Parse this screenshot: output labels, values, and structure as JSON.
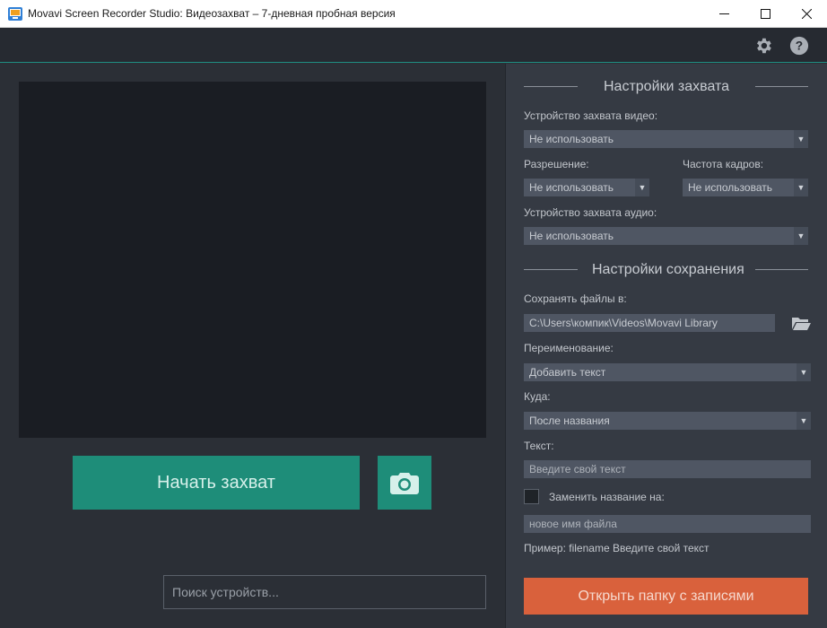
{
  "window": {
    "title": "Movavi Screen Recorder Studio: Видеозахват – 7-дневная пробная версия",
    "minimize_glyph": "—",
    "maximize_glyph": "☐",
    "close_glyph": "✕"
  },
  "toolbar": {
    "settings_icon": "gear-icon",
    "help_icon": "help-icon"
  },
  "preview": {
    "start_label": "Начать захват",
    "snapshot_icon": "camera-icon",
    "search_placeholder": "Поиск устройств..."
  },
  "capture_settings": {
    "title": "Настройки захвата",
    "video_device_label": "Устройство захвата видео:",
    "video_device_value": "Не использовать",
    "resolution_label": "Разрешение:",
    "resolution_value": "Не использовать",
    "framerate_label": "Частота кадров:",
    "framerate_value": "Не использовать",
    "audio_device_label": "Устройство захвата аудио:",
    "audio_device_value": "Не использовать"
  },
  "save_settings": {
    "title": "Настройки сохранения",
    "save_to_label": "Сохранять файлы в:",
    "save_to_value": "C:\\Users\\компик\\Videos\\Movavi Library",
    "rename_label": "Переименование:",
    "rename_value": "Добавить текст",
    "where_label": "Куда:",
    "where_value": "После названия",
    "text_label": "Текст:",
    "text_placeholder": "Введите свой текст",
    "replace_label": "Заменить название на:",
    "replace_checked": false,
    "replace_placeholder": "новое имя файла",
    "example_text": "Пример: filename Введите свой текст",
    "open_folder_label": "Открыть папку с записями"
  },
  "colors": {
    "accent_green": "#1e8d79",
    "accent_orange": "#d9613c",
    "panel_dark": "#2b2f36",
    "panel_right": "#353a43"
  }
}
